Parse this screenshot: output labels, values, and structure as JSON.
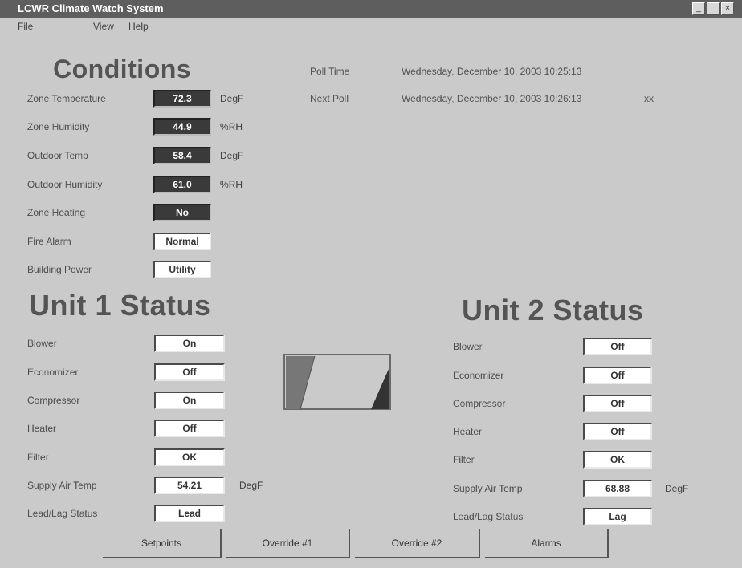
{
  "window": {
    "title": "LCWR Climate Watch System",
    "controls": [
      "_",
      "□",
      "×"
    ]
  },
  "menu": {
    "items": [
      "File",
      "View",
      "Help"
    ]
  },
  "conditions": {
    "title": "Conditions",
    "rows": [
      {
        "label": "Zone Temperature",
        "value": "72.3",
        "unit": "DegF"
      },
      {
        "label": "Zone Humidity",
        "value": "44.9",
        "unit": "%RH"
      },
      {
        "label": "Outdoor Temp",
        "value": "58.4",
        "unit": "DegF"
      },
      {
        "label": "Outdoor Humidity",
        "value": "61.0",
        "unit": "%RH"
      },
      {
        "label": "Zone Heating",
        "value": "No",
        "unit": ""
      },
      {
        "label": "Fire Alarm",
        "value": "Normal",
        "unit": ""
      },
      {
        "label": "Building Power",
        "value": "Utility",
        "unit": ""
      }
    ]
  },
  "info": {
    "rows": [
      {
        "label": "Poll Time",
        "value": "Wednesday, December 10, 2003 10:25:13",
        "extra": ""
      },
      {
        "label": "Next Poll",
        "value": "Wednesday, December 10, 2003 10:26:13",
        "extra": "xx"
      }
    ]
  },
  "unit1": {
    "title": "Unit 1 Status",
    "rows": [
      {
        "label": "Blower",
        "value": "On",
        "unit": ""
      },
      {
        "label": "Economizer",
        "value": "Off",
        "unit": ""
      },
      {
        "label": "Compressor",
        "value": "On",
        "unit": ""
      },
      {
        "label": "Heater",
        "value": "Off",
        "unit": ""
      },
      {
        "label": "Filter",
        "value": "OK",
        "unit": ""
      },
      {
        "label": "Supply Air Temp",
        "value": "54.21",
        "unit": "DegF"
      },
      {
        "label": "Lead/Lag Status",
        "value": "Lead",
        "unit": ""
      }
    ]
  },
  "unit2": {
    "title": "Unit 2 Status",
    "rows": [
      {
        "label": "Blower",
        "value": "Off",
        "unit": ""
      },
      {
        "label": "Economizer",
        "value": "Off",
        "unit": ""
      },
      {
        "label": "Compressor",
        "value": "Off",
        "unit": ""
      },
      {
        "label": "Heater",
        "value": "Off",
        "unit": ""
      },
      {
        "label": "Filter",
        "value": "OK",
        "unit": ""
      },
      {
        "label": "Supply Air Temp",
        "value": "68.88",
        "unit": "DegF"
      },
      {
        "label": "Lead/Lag Status",
        "value": "Lag",
        "unit": ""
      }
    ]
  },
  "buttons": [
    "Setpoints",
    "Override #1",
    "Override #2",
    "Alarms"
  ]
}
